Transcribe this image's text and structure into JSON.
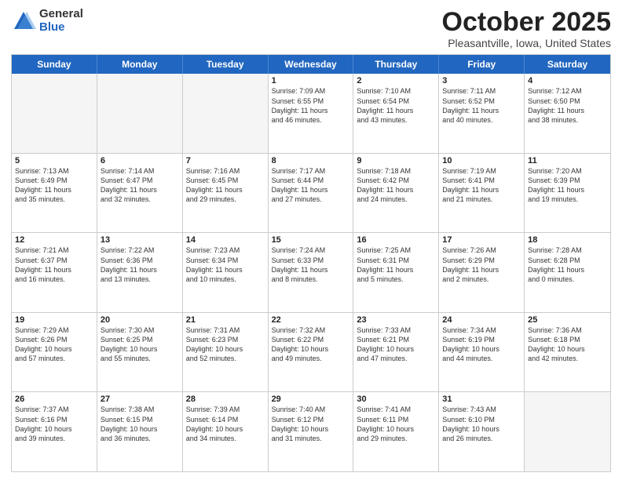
{
  "logo": {
    "general": "General",
    "blue": "Blue"
  },
  "title": {
    "month": "October 2025",
    "location": "Pleasantville, Iowa, United States"
  },
  "days_of_week": [
    "Sunday",
    "Monday",
    "Tuesday",
    "Wednesday",
    "Thursday",
    "Friday",
    "Saturday"
  ],
  "weeks": [
    [
      {
        "day": "",
        "empty": true
      },
      {
        "day": "",
        "empty": true
      },
      {
        "day": "",
        "empty": true
      },
      {
        "day": "1",
        "info": "Sunrise: 7:09 AM\nSunset: 6:55 PM\nDaylight: 11 hours\nand 46 minutes."
      },
      {
        "day": "2",
        "info": "Sunrise: 7:10 AM\nSunset: 6:54 PM\nDaylight: 11 hours\nand 43 minutes."
      },
      {
        "day": "3",
        "info": "Sunrise: 7:11 AM\nSunset: 6:52 PM\nDaylight: 11 hours\nand 40 minutes."
      },
      {
        "day": "4",
        "info": "Sunrise: 7:12 AM\nSunset: 6:50 PM\nDaylight: 11 hours\nand 38 minutes."
      }
    ],
    [
      {
        "day": "5",
        "info": "Sunrise: 7:13 AM\nSunset: 6:49 PM\nDaylight: 11 hours\nand 35 minutes."
      },
      {
        "day": "6",
        "info": "Sunrise: 7:14 AM\nSunset: 6:47 PM\nDaylight: 11 hours\nand 32 minutes."
      },
      {
        "day": "7",
        "info": "Sunrise: 7:16 AM\nSunset: 6:45 PM\nDaylight: 11 hours\nand 29 minutes."
      },
      {
        "day": "8",
        "info": "Sunrise: 7:17 AM\nSunset: 6:44 PM\nDaylight: 11 hours\nand 27 minutes."
      },
      {
        "day": "9",
        "info": "Sunrise: 7:18 AM\nSunset: 6:42 PM\nDaylight: 11 hours\nand 24 minutes."
      },
      {
        "day": "10",
        "info": "Sunrise: 7:19 AM\nSunset: 6:41 PM\nDaylight: 11 hours\nand 21 minutes."
      },
      {
        "day": "11",
        "info": "Sunrise: 7:20 AM\nSunset: 6:39 PM\nDaylight: 11 hours\nand 19 minutes."
      }
    ],
    [
      {
        "day": "12",
        "info": "Sunrise: 7:21 AM\nSunset: 6:37 PM\nDaylight: 11 hours\nand 16 minutes."
      },
      {
        "day": "13",
        "info": "Sunrise: 7:22 AM\nSunset: 6:36 PM\nDaylight: 11 hours\nand 13 minutes."
      },
      {
        "day": "14",
        "info": "Sunrise: 7:23 AM\nSunset: 6:34 PM\nDaylight: 11 hours\nand 10 minutes."
      },
      {
        "day": "15",
        "info": "Sunrise: 7:24 AM\nSunset: 6:33 PM\nDaylight: 11 hours\nand 8 minutes."
      },
      {
        "day": "16",
        "info": "Sunrise: 7:25 AM\nSunset: 6:31 PM\nDaylight: 11 hours\nand 5 minutes."
      },
      {
        "day": "17",
        "info": "Sunrise: 7:26 AM\nSunset: 6:29 PM\nDaylight: 11 hours\nand 2 minutes."
      },
      {
        "day": "18",
        "info": "Sunrise: 7:28 AM\nSunset: 6:28 PM\nDaylight: 11 hours\nand 0 minutes."
      }
    ],
    [
      {
        "day": "19",
        "info": "Sunrise: 7:29 AM\nSunset: 6:26 PM\nDaylight: 10 hours\nand 57 minutes."
      },
      {
        "day": "20",
        "info": "Sunrise: 7:30 AM\nSunset: 6:25 PM\nDaylight: 10 hours\nand 55 minutes."
      },
      {
        "day": "21",
        "info": "Sunrise: 7:31 AM\nSunset: 6:23 PM\nDaylight: 10 hours\nand 52 minutes."
      },
      {
        "day": "22",
        "info": "Sunrise: 7:32 AM\nSunset: 6:22 PM\nDaylight: 10 hours\nand 49 minutes."
      },
      {
        "day": "23",
        "info": "Sunrise: 7:33 AM\nSunset: 6:21 PM\nDaylight: 10 hours\nand 47 minutes."
      },
      {
        "day": "24",
        "info": "Sunrise: 7:34 AM\nSunset: 6:19 PM\nDaylight: 10 hours\nand 44 minutes."
      },
      {
        "day": "25",
        "info": "Sunrise: 7:36 AM\nSunset: 6:18 PM\nDaylight: 10 hours\nand 42 minutes."
      }
    ],
    [
      {
        "day": "26",
        "info": "Sunrise: 7:37 AM\nSunset: 6:16 PM\nDaylight: 10 hours\nand 39 minutes."
      },
      {
        "day": "27",
        "info": "Sunrise: 7:38 AM\nSunset: 6:15 PM\nDaylight: 10 hours\nand 36 minutes."
      },
      {
        "day": "28",
        "info": "Sunrise: 7:39 AM\nSunset: 6:14 PM\nDaylight: 10 hours\nand 34 minutes."
      },
      {
        "day": "29",
        "info": "Sunrise: 7:40 AM\nSunset: 6:12 PM\nDaylight: 10 hours\nand 31 minutes."
      },
      {
        "day": "30",
        "info": "Sunrise: 7:41 AM\nSunset: 6:11 PM\nDaylight: 10 hours\nand 29 minutes."
      },
      {
        "day": "31",
        "info": "Sunrise: 7:43 AM\nSunset: 6:10 PM\nDaylight: 10 hours\nand 26 minutes."
      },
      {
        "day": "",
        "empty": true
      }
    ]
  ]
}
